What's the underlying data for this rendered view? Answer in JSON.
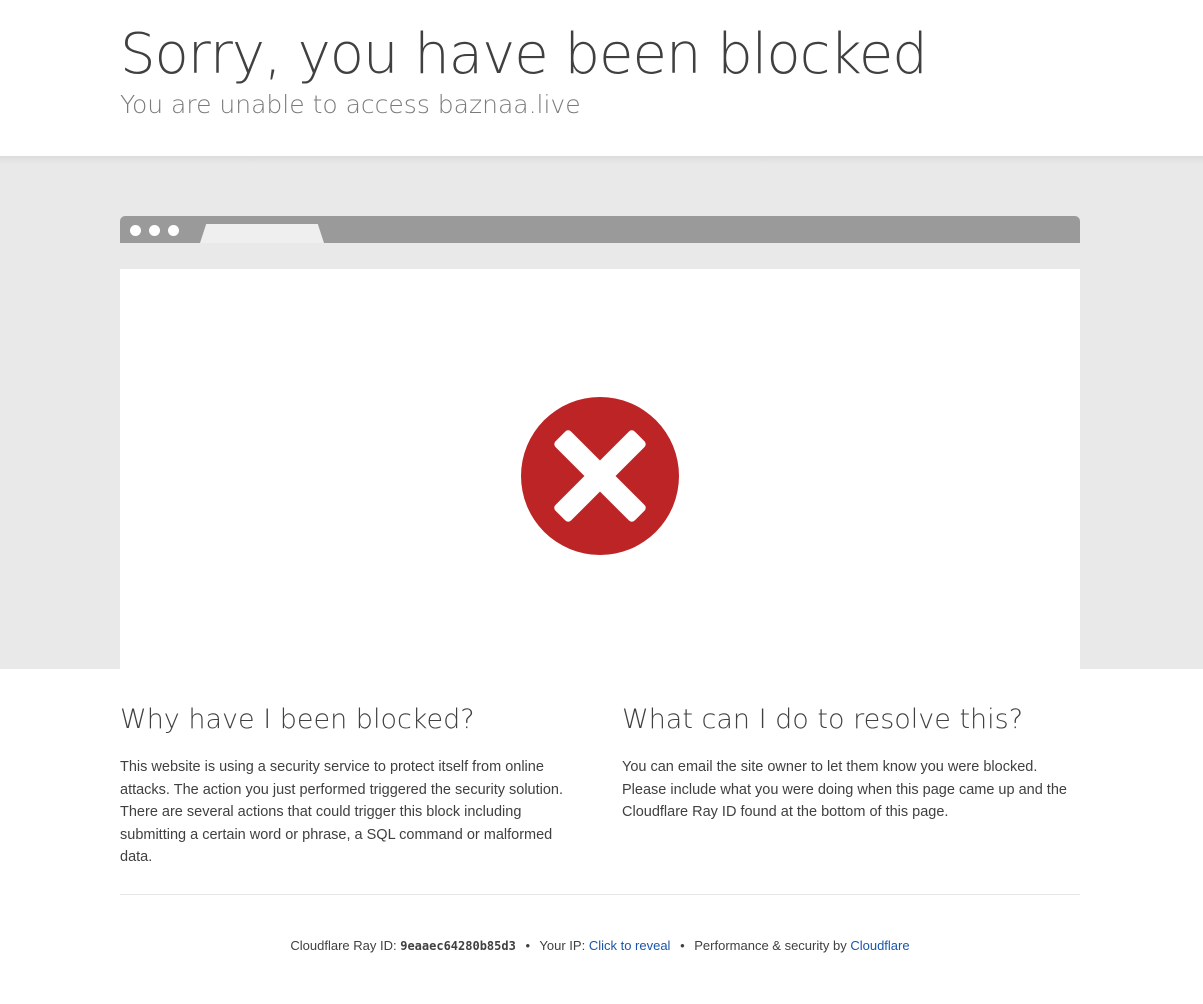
{
  "header": {
    "title": "Sorry, you have been blocked",
    "subtitle": "You are unable to access baznaa.live"
  },
  "browser": {
    "icon": "error-x-icon",
    "icon_color": "#bd2426"
  },
  "why": {
    "heading": "Why have I been blocked?",
    "body": "This website is using a security service to protect itself from online attacks. The action you just performed triggered the security solution. There are several actions that could trigger this block including submitting a certain word or phrase, a SQL command or malformed data."
  },
  "resolve": {
    "heading": "What can I do to resolve this?",
    "body": "You can email the site owner to let them know you were blocked. Please include what you were doing when this page came up and the Cloudflare Ray ID found at the bottom of this page."
  },
  "footer": {
    "ray_label": "Cloudflare Ray ID:",
    "ray_id": "9eaaec64280b85d3",
    "separator": "•",
    "ip_label": "Your IP:",
    "ip_link": "Click to reveal",
    "perf_label": "Performance & security by",
    "perf_link": "Cloudflare",
    "link_color": "#1a55a8"
  }
}
